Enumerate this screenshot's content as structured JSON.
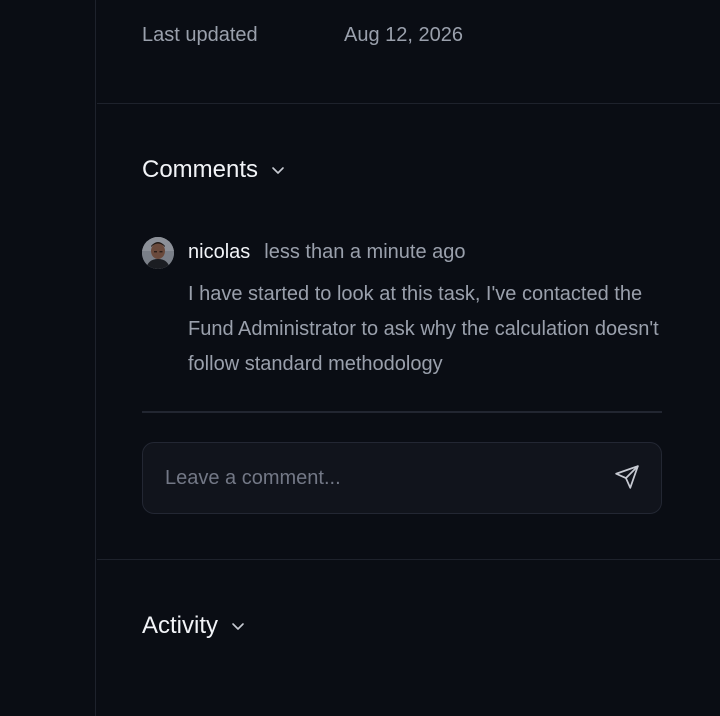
{
  "meta": {
    "last_updated_label": "Last updated",
    "last_updated_value": "Aug 12, 2026"
  },
  "comments_section": {
    "title": "Comments",
    "items": [
      {
        "author": "nicolas",
        "time": "less than a minute ago",
        "text": "I have started to look at this task, I've contacted the Fund Administrator to ask why the calculation doesn't follow standard methodology"
      }
    ],
    "input_placeholder": "Leave a comment...",
    "send_icon": "send-icon"
  },
  "activity_section": {
    "title": "Activity"
  },
  "colors": {
    "background": "#0a0d14",
    "text_primary": "#f2f4f8",
    "text_secondary": "#9aa0ac",
    "border": "#1e222c"
  }
}
